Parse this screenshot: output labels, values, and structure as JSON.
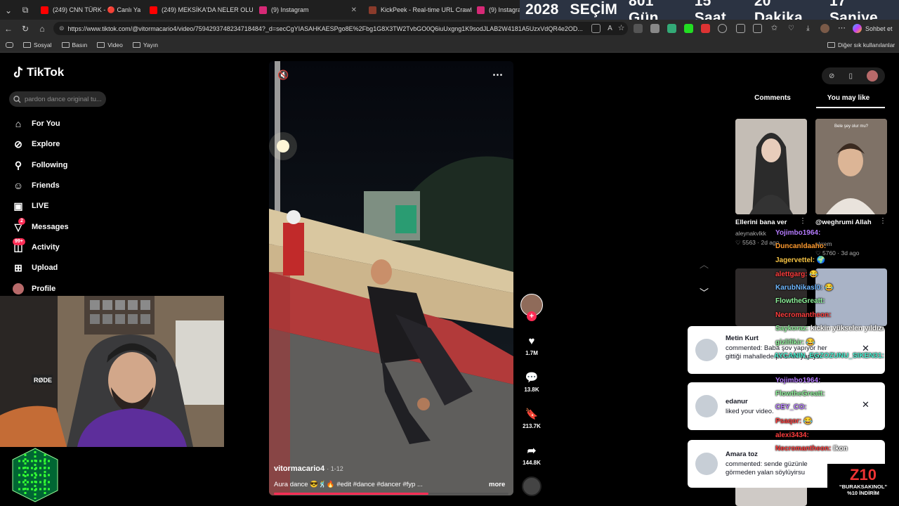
{
  "browser": {
    "tabs": [
      {
        "label": "(249) CNN TÜRK - 🔴 Canlı Yayın",
        "color": "#ff0000"
      },
      {
        "label": "(249) MEKSİKA'DA NELER OLUYO",
        "color": "#ff0000"
      },
      {
        "label": "(9) Instagram",
        "color": "#d62976"
      },
      {
        "label": "KickPeek - Real-time URL Crawler",
        "color": "#8a3b2b"
      },
      {
        "label": "(9) Instagram",
        "color": "#d62976"
      }
    ],
    "url": "https://www.tiktok.com/@vitormacario4/video/7594293748234718484?_d=secCgYIASAHKAESPgo8E%2Fbg1G8X3TW2TvbGO0Q6iuUxgng1K9sodJLAB2W4181A5UzxVdQR4e2OD...",
    "chat_button": "Sohbet et",
    "bookmarks": [
      "Sosyal",
      "Basın",
      "Video",
      "Yayın"
    ],
    "other_bookmarks": "Diğer sık kullanılanlar"
  },
  "countdown": [
    "2028",
    "SEÇİM",
    "801 Gün",
    "15 Saat",
    "20 Dakika",
    "17 Saniye"
  ],
  "tiktok": {
    "logo": "TikTok",
    "search_placeholder": "pardon dance original tu...",
    "nav": [
      {
        "label": "For You",
        "icon": "home-icon"
      },
      {
        "label": "Explore",
        "icon": "compass-icon"
      },
      {
        "label": "Following",
        "icon": "user-plus-icon"
      },
      {
        "label": "Friends",
        "icon": "friends-icon"
      },
      {
        "label": "LIVE",
        "icon": "live-icon"
      },
      {
        "label": "Messages",
        "icon": "send-icon",
        "badge": "2"
      },
      {
        "label": "Activity",
        "icon": "bell-icon",
        "badge": "99+"
      },
      {
        "label": "Upload",
        "icon": "plus-square-icon"
      },
      {
        "label": "Profile",
        "icon": "avatar"
      }
    ],
    "video": {
      "author": "vitormacario4",
      "date": "· 1-12",
      "caption": "Aura dance 😎🕺🔥 #edit #dance #dancer #fyp ...",
      "more": "more",
      "progress": 0.66
    },
    "actions": [
      {
        "name": "like",
        "icon": "heart-icon",
        "count": "1.7M"
      },
      {
        "name": "comment",
        "icon": "comment-icon",
        "count": "13.8K"
      },
      {
        "name": "save",
        "icon": "bookmark-icon",
        "count": "213.7K"
      },
      {
        "name": "share",
        "icon": "share-icon",
        "count": "144.8K"
      }
    ],
    "panel_tabs": [
      "Comments",
      "You may like"
    ],
    "cards": [
      {
        "title": "Ellerini bana ver",
        "user": "aleynakvlkk",
        "likes": "5563",
        "date": "2d ago"
      },
      {
        "title": "@weghrumi Allah",
        "user": "ekrem",
        "likes": "5760",
        "date": "3d ago"
      }
    ]
  },
  "notifications": [
    {
      "name": "Metin Kurt",
      "text": "commented: Baba şov yapıyor her gittiği mahallede polemik yapıyor"
    },
    {
      "name": "edanur",
      "text": "liked your video."
    },
    {
      "name": "Amara toz",
      "text": "commented: sende güzünle görmeden yalan söylüyirsu"
    }
  ],
  "chat": [
    {
      "user": "Yojimbo1964:",
      "msg": "",
      "color": "#b57bff"
    },
    {
      "user": "Duncanldaaho:",
      "msg": "",
      "color": "#ff9a2e"
    },
    {
      "user": "Jagervettel:",
      "msg": "🌍",
      "color": "#f6c343"
    },
    {
      "user": "alettgarg:",
      "msg": "😂",
      "color": "#ff3d3d"
    },
    {
      "user": "KarubNikasl0:",
      "msg": "😂",
      "color": "#6fb7ff"
    },
    {
      "user": "FlowtheGreatt:",
      "msg": "",
      "color": "#8ef29a"
    },
    {
      "user": "Necromantheon:",
      "msg": "",
      "color": "#ff3d3d"
    },
    {
      "user": "Saykoraz:",
      "msg": "kickin yükselen yıldızı",
      "color": "#8ef29a"
    },
    {
      "user": "gizlifikir:",
      "msg": "😂",
      "color": "#8ef29a"
    },
    {
      "user": "AYCANIN_EGZOZUNU_SIKEN31:",
      "msg": "",
      "color": "#49f2d2"
    },
    {
      "user": "Yojimbo1964:",
      "msg": "",
      "color": "#b57bff"
    },
    {
      "user": "FlowtheGreatt:",
      "msg": "",
      "color": "#8ef29a"
    },
    {
      "user": "CEY_CO:",
      "msg": "",
      "color": "#b57bff"
    },
    {
      "user": "Psaqor:",
      "msg": "😂",
      "color": "#ff3d3d"
    },
    {
      "user": "alexi3434:",
      "msg": "",
      "color": "#ff3d3d"
    },
    {
      "user": "Necromantheon:",
      "msg": "Ikon",
      "color": "#ff3d3d"
    }
  ],
  "promo": {
    "brand": "Z10",
    "line1": "“BURAKSAKINOL”",
    "line2": "%10 İNDİRİM"
  },
  "colors": {
    "accent": "#fe2c55",
    "bg": "#000000"
  }
}
